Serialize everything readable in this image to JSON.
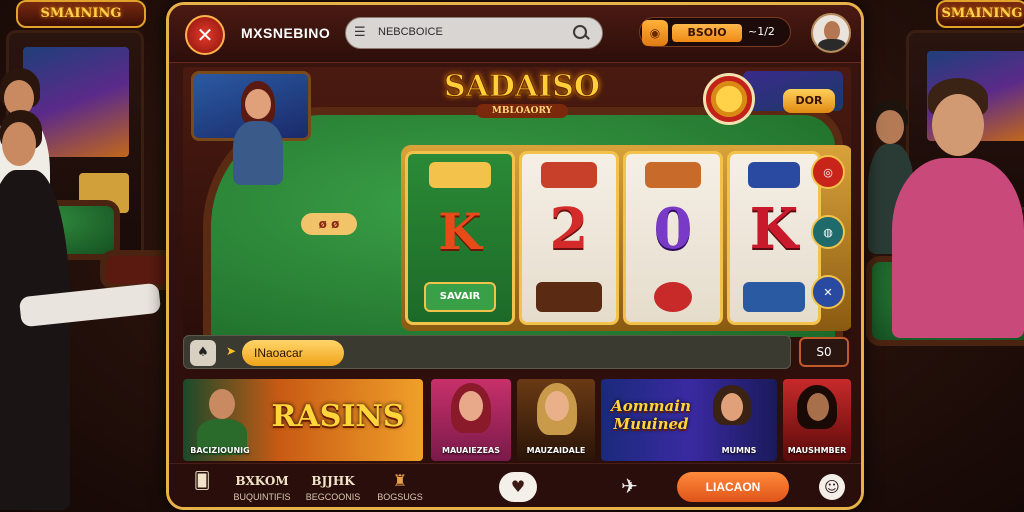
{
  "background": {
    "marquee_left": "SMAINING",
    "marquee_right": "SMAINING"
  },
  "header": {
    "logo_icon": "x-logo-icon",
    "logo_glyph": "✕",
    "brand": "MXSNEBINO",
    "search_placeholder": "NEBCBOICE",
    "wallet_amount": "BSOIO",
    "wallet_delta": "~1/2"
  },
  "game": {
    "title": "SADAISO",
    "subtitle": "MBLOAORY",
    "top_pill": "DOR",
    "dice_label": "ø ø",
    "reels": [
      {
        "symbol": "K",
        "top_label": "ΛΛΛ",
        "bottom_label": "SAVAIR",
        "color": "#e8402a"
      },
      {
        "symbol": "2",
        "top_label": "",
        "bottom_label": "",
        "color": "#d42a2a"
      },
      {
        "symbol": "0",
        "top_label": "",
        "bottom_label": "",
        "color": "#7a3ac8"
      },
      {
        "symbol": "K",
        "top_label": "",
        "bottom_label": "",
        "color": "#c81a2a"
      }
    ]
  },
  "status_bar": {
    "icon": "card-icon",
    "label": "INaoacar",
    "bet": "S0"
  },
  "promos": [
    {
      "big": "RASINS",
      "caption": "BACIZIOUNIG"
    },
    {
      "big": "",
      "caption": "MAUAIEZEAS"
    },
    {
      "big": "",
      "caption": "MAUZAIDALE"
    },
    {
      "big": "Aommain Muuined",
      "caption": "MUMNS"
    },
    {
      "big": "",
      "caption": "MAUSHMBER"
    }
  ],
  "nav": {
    "items": [
      {
        "glyph": "🂠",
        "label": ""
      },
      {
        "glyph": "BXKOM",
        "label": "BUQUINTIFIS"
      },
      {
        "glyph": "BJJHK",
        "label": "BEGCOONIS"
      },
      {
        "glyph": "♜",
        "label": "BOGSUGS"
      }
    ],
    "cta": "LIACAON"
  },
  "colors": {
    "accent": "#ffcf3a",
    "frame": "#e8b24a",
    "felt": "#2a8a36",
    "cta": "#f06a2a"
  }
}
